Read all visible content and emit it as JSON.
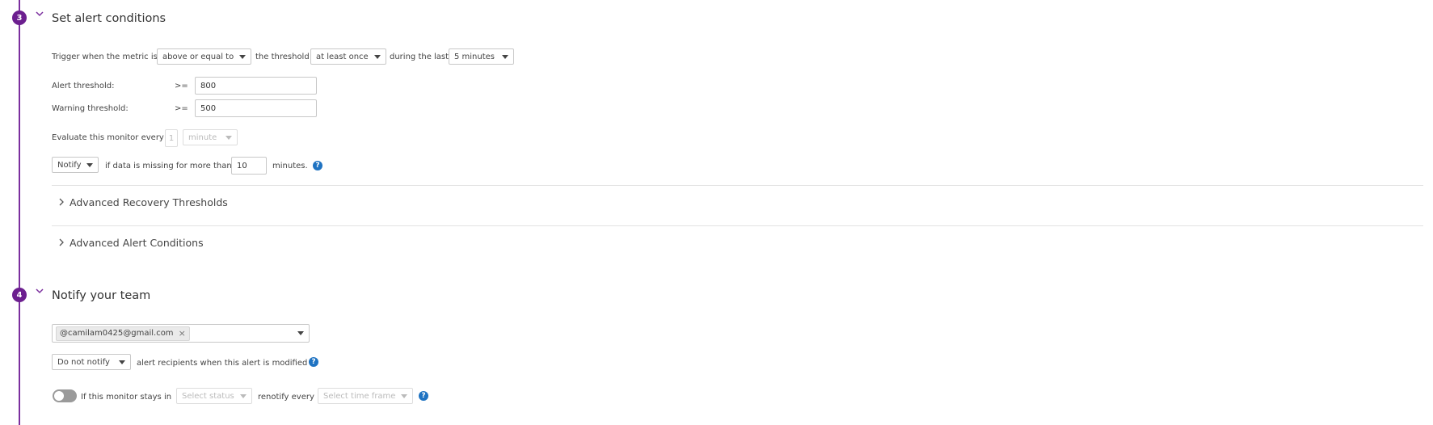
{
  "section3": {
    "number": "3",
    "title": "Set alert conditions",
    "trigger": {
      "prefix": "Trigger when the metric is",
      "comparison": "above or equal to",
      "mid": "the threshold",
      "occurrence": "at least once",
      "during": "during the last",
      "window": "5 minutes"
    },
    "alert_threshold": {
      "label": "Alert threshold:",
      "op": ">=",
      "value": "800"
    },
    "warning_threshold": {
      "label": "Warning threshold:",
      "op": ">=",
      "value": "500"
    },
    "evaluate": {
      "label": "Evaluate this monitor every",
      "value": "1",
      "unit": "minute"
    },
    "missing": {
      "action": "Notify",
      "text": "if data is missing for more than",
      "value": "10",
      "suffix": "minutes."
    },
    "advanced_recovery": "Advanced Recovery Thresholds",
    "advanced_alert": "Advanced Alert Conditions"
  },
  "section4": {
    "number": "4",
    "title": "Notify your team",
    "recipient_chip": "@camilam0425@gmail.com",
    "modify": {
      "action": "Do not notify",
      "text": "alert recipients when this alert is modified"
    },
    "renotify": {
      "prefix": "If this monitor stays in",
      "status_placeholder": "Select status",
      "mid": "renotify every",
      "timeframe_placeholder": "Select time frame"
    }
  },
  "icons": {
    "help": "?",
    "chip_close": "×",
    "chevron_down": "﹀",
    "chevron_right": "›"
  },
  "colors": {
    "accent": "#6c1f8f",
    "help": "#1f73c2"
  }
}
